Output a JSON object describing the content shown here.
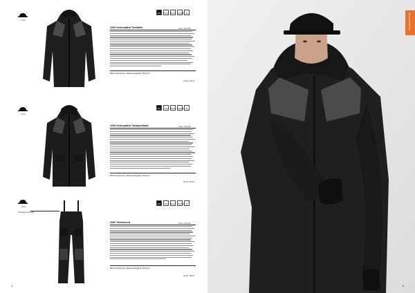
{
  "left_page": {
    "page_number": "4",
    "products": [
      {
        "hat_label": "Narvik",
        "title": "1009 Vedenpitävä Talvitakki",
        "sizes": "Koot: XS-4XL",
        "size_note": "996 Kuviopainote, takaosa kangasta: 350 g/m²",
        "price": "Hinta: 229 €",
        "icons": [
          "EN",
          "343",
          "ECO",
          "WASH",
          "♻"
        ]
      },
      {
        "hat_label": "Narvik",
        "title": "1008 Vedenpitävä Talvipuolitakki",
        "sizes": "Koot: XS-4XL",
        "size_note": "996 Kuviopainote, takaosa kangasta: 350 g/m²",
        "price": "Hinta: 229 €",
        "icons": [
          "EN",
          "343",
          "ECO",
          "WASH",
          "♻"
        ]
      },
      {
        "hat_label": "Narvik",
        "title": "2536 Talvihousut",
        "sizes": "Koot: XS-4XL",
        "size_note": "996 Kuviopainote, takaosa kangasta: 250 g/m²",
        "price": "Hinta: 189 €",
        "icons": [
          "EN",
          "343",
          "ECO",
          "WASH",
          "♻"
        ],
        "callout": "Irrotettavat henkselit"
      }
    ]
  },
  "right_page": {
    "page_number": "5",
    "tab_label": "TALVIVAATTEET"
  }
}
